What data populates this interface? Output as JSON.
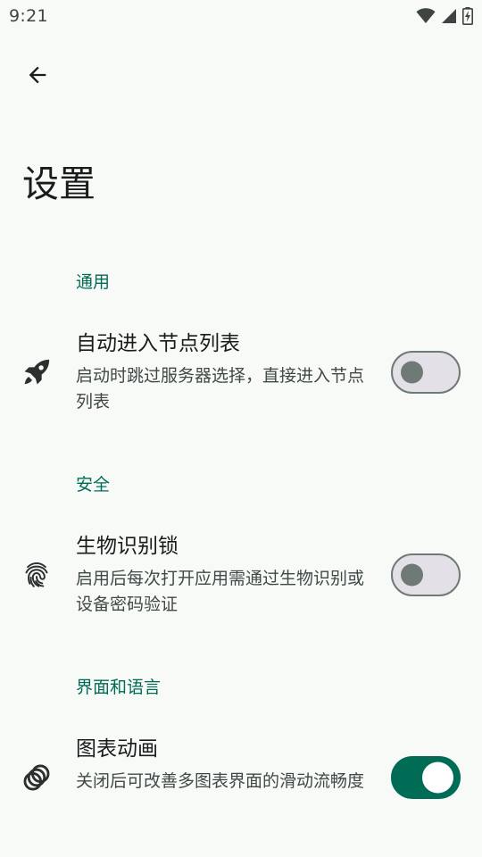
{
  "status_bar": {
    "time": "9:21",
    "icons": [
      "wifi-icon",
      "cell-signal-icon",
      "battery-charging-icon"
    ]
  },
  "toolbar": {
    "back_icon": "arrow-back-icon"
  },
  "page": {
    "title": "设置"
  },
  "sections": [
    {
      "header": "通用",
      "items": [
        {
          "icon": "rocket-icon",
          "title": "自动进入节点列表",
          "summary": "启动时跳过服务器选择，直接进入节点列表",
          "enabled": false
        }
      ]
    },
    {
      "header": "安全",
      "items": [
        {
          "icon": "fingerprint-icon",
          "title": "生物识别锁",
          "summary": "启用后每次打开应用需通过生物识别或设备密码验证",
          "enabled": false
        }
      ]
    },
    {
      "header": "界面和语言",
      "items": [
        {
          "icon": "animation-icon",
          "title": "图表动画",
          "summary": "关闭后可改善多图表界面的滑动流畅度",
          "enabled": true
        }
      ]
    }
  ],
  "colors": {
    "background": "#f8faf8",
    "accent": "#006c56",
    "switch_off_track": "#e3e1e7",
    "switch_off_outline": "#6f7975"
  }
}
